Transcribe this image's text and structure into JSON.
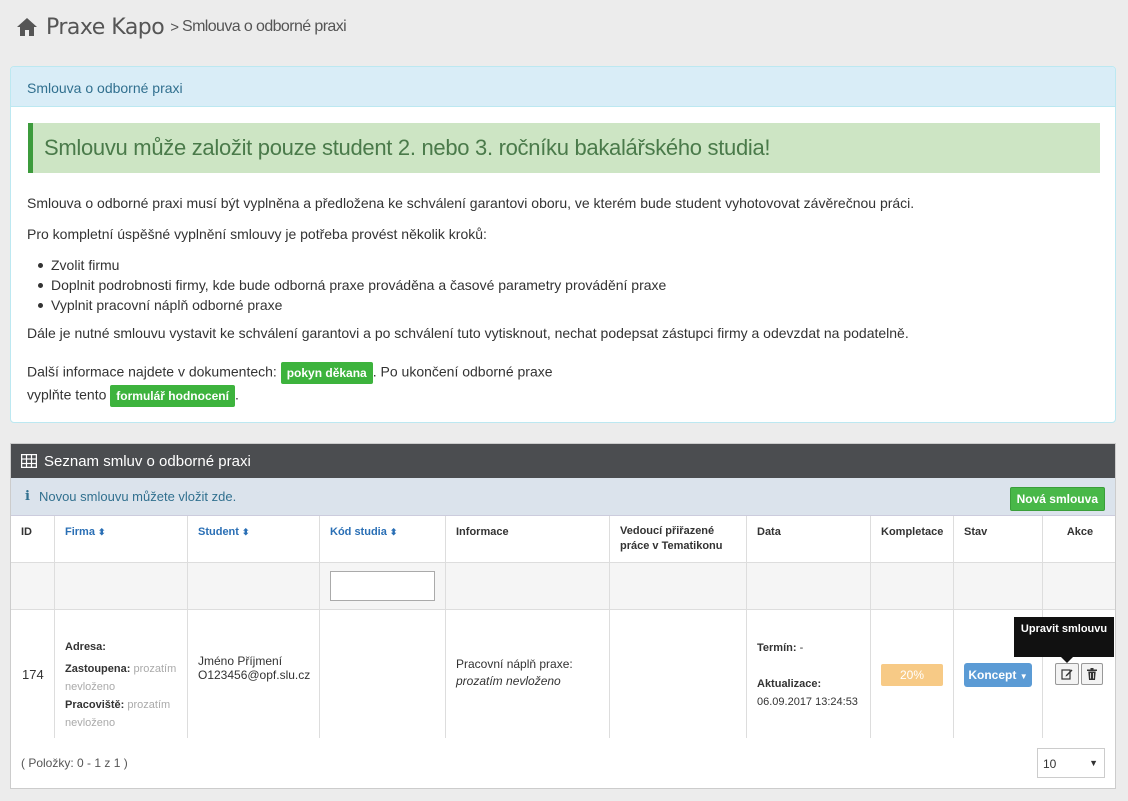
{
  "breadcrumb": {
    "app": "Praxe Kapo",
    "separator": ">",
    "current": "Smlouva o odborné praxi"
  },
  "intro_panel": {
    "title": "Smlouva o odborné praxi",
    "alert": "Smlouvu může založit pouze student 2. nebo 3. ročníku bakalářského studia!",
    "para1": "Smlouva o odborné praxi musí být vyplněna a předložena ke schválení garantovi oboru, ve kterém bude student vyhotovovat závěrečnou práci.",
    "para2": "Pro kompletní úspěšné vyplnění smlouvy je potřeba provést několik kroků:",
    "steps": [
      "Zvolit firmu",
      "Doplnit podrobnosti firmy, kde bude odborná praxe prováděna a časové parametry provádění praxe",
      "Vyplnit pracovní náplň odborné praxe"
    ],
    "para3": "Dále je nutné smlouvu vystavit ke schválení garantovi a po schválení tuto vytisknout, nechat podepsat zástupci firmy a odevzdat na podatelně.",
    "docs_prefix": "Další informace najdete v dokumentech:",
    "docs_link": "pokyn děkana",
    "docs_middle": ". Po ukončení odborné praxe",
    "docs_prefix2": "vyplňte tento",
    "form_link": "formulář hodnocení",
    "docs_suffix": "."
  },
  "list_panel": {
    "title": "Seznam smluv o odborné praxi",
    "info": "Novou smlouvu můžete vložit zde.",
    "new_button": "Nová smlouva",
    "columns": [
      "ID",
      "Firma",
      "Student",
      "Kód studia",
      "Informace",
      "Vedoucí přiřazené práce v Tematikonu",
      "Data",
      "Kompletace",
      "Stav",
      "Akce"
    ],
    "row": {
      "id": "174",
      "address_label": "Adresa:",
      "represented_label": "Zastoupena:",
      "represented_value": "prozatím nevloženo",
      "workplace_label": "Pracoviště:",
      "workplace_value": "prozatím nevloženo",
      "student_name": "Jméno Příjmení",
      "student_email": "O123456@opf.slu.cz",
      "info_label": "Pracovní náplň praxe:",
      "info_value": "prozatím nevloženo",
      "term_label": "Termín:",
      "term_value": "-",
      "updated_label": "Aktualizace:",
      "updated_value": "06.09.2017 13:24:53",
      "completion": "20%",
      "status": "Koncept"
    },
    "tooltip": "Upravit smlouvu",
    "footer": "( Položky: 0 - 1 z 1 )",
    "page_size": "10"
  },
  "colors": {
    "accent_green": "#3db33d",
    "info_blue": "#31708f",
    "header_dark": "#4b4d50",
    "progress": "#f7ca86"
  }
}
